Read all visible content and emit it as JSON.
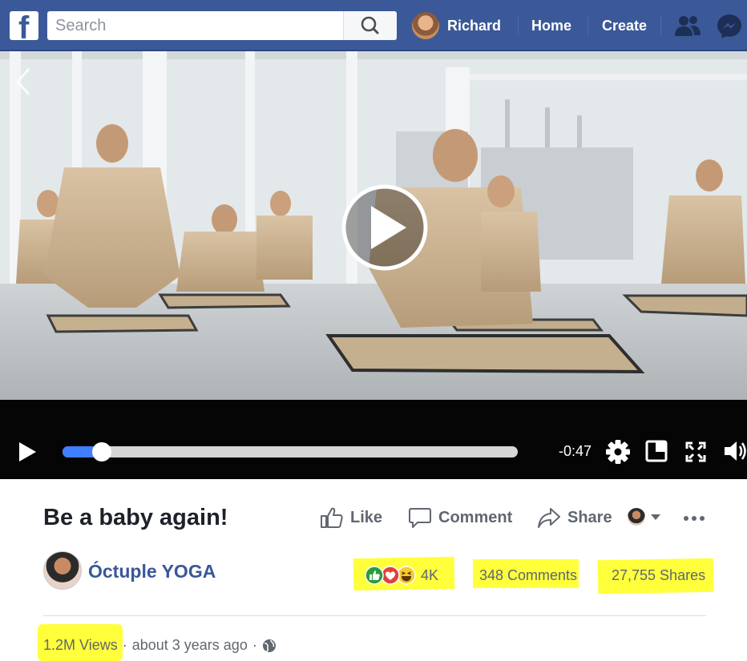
{
  "topbar": {
    "search_placeholder": "Search",
    "user_name": "Richard",
    "home_label": "Home",
    "create_label": "Create"
  },
  "video": {
    "time_remaining": "-0:47",
    "progress": 0.05
  },
  "post": {
    "title": "Be a baby again!",
    "actions": {
      "like": "Like",
      "comment": "Comment",
      "share": "Share"
    },
    "page_name": "Óctuple YOGA",
    "reactions_count": "4K",
    "comments_count": "348 Comments",
    "shares_count": "27,755 Shares",
    "views": "1.2M Views",
    "separator": "·",
    "time_ago": "about 3 years ago"
  },
  "colors": {
    "brand": "#3b5998",
    "highlight": "#ffff3b",
    "link": "#385898",
    "muted": "#606770"
  }
}
